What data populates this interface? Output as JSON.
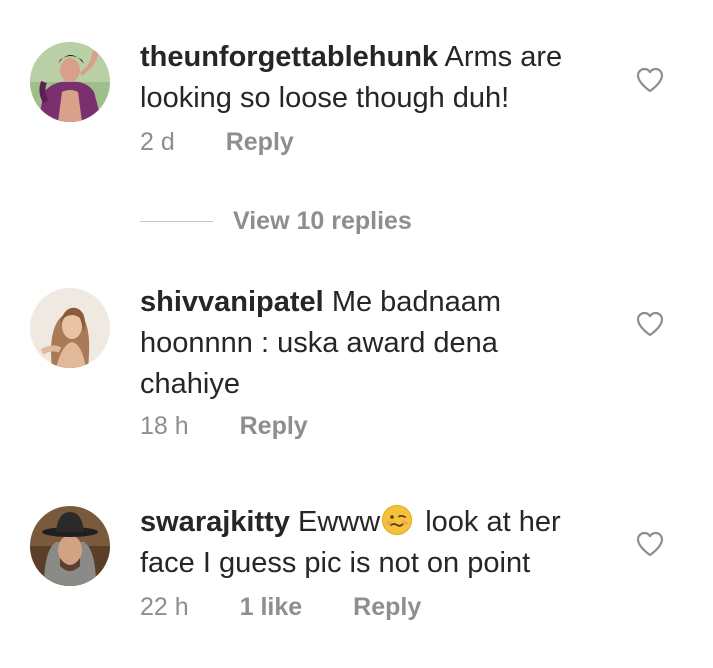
{
  "comments": [
    {
      "username": "theunforgettablehunk",
      "text": "Arms are looking so loose though duh!",
      "time": "2 d",
      "reply_label": "Reply",
      "avatar_icon": "user-avatar-shirtless-man"
    },
    {
      "username": "shivvanipatel",
      "text": "Me badnaam hoonnnn : uska award dena chahiye",
      "time": "18 h",
      "reply_label": "Reply",
      "avatar_icon": "user-avatar-woman"
    },
    {
      "username": "swarajkitty",
      "text_before": "Ewww",
      "emoji_icon": "woozy-face-emoji",
      "text_after": " look at her face I guess pic is not on point",
      "time": "22 h",
      "likes": "1 like",
      "reply_label": "Reply",
      "avatar_icon": "user-avatar-man-hat"
    }
  ],
  "view_replies": {
    "label": "View 10 replies"
  },
  "icons": {
    "like": "heart-outline-icon"
  },
  "colors": {
    "text": "#262626",
    "secondary": "#8e8e8e",
    "divider": "#c7c7c7"
  }
}
